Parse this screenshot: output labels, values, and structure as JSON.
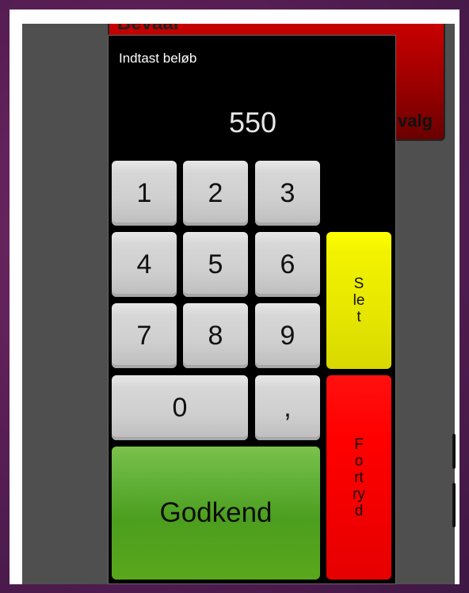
{
  "background": {
    "title_fragment": "Bevaar",
    "button_fragment": "valg"
  },
  "dialog": {
    "title": "Indtast beløb",
    "amount": "550"
  },
  "keypad": {
    "k1": "1",
    "k2": "2",
    "k3": "3",
    "k4": "4",
    "k5": "5",
    "k6": "6",
    "k7": "7",
    "k8": "8",
    "k9": "9",
    "k0": "0",
    "comma": ","
  },
  "actions": {
    "delete_label": "Slet",
    "cancel_label": "Fortryd",
    "confirm_label": "Godkend"
  },
  "colors": {
    "delete": "#e6e600",
    "cancel": "#ff0000",
    "confirm": "#5aa71c"
  }
}
